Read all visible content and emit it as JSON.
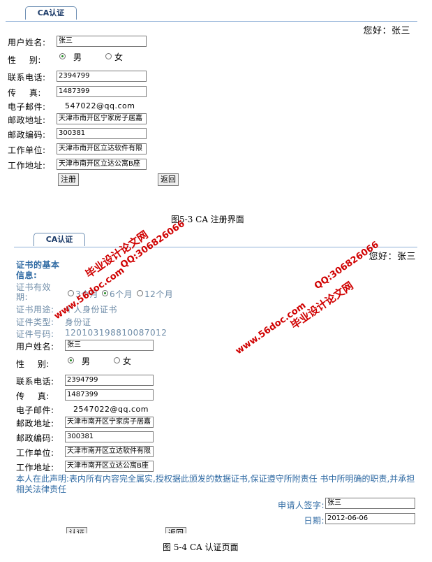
{
  "form1": {
    "tab": "CA认证",
    "greeting": "您好：张三",
    "labels": {
      "name": "用户姓名:",
      "gender": "性 别:",
      "phone": "联系电话:",
      "fax": "传 真:",
      "email": "电子邮件:",
      "address": "邮政地址:",
      "zip": "邮政编码:",
      "work_unit": "工作单位:",
      "work_address": "工作地址:"
    },
    "values": {
      "name": "张三",
      "gender_male": "男",
      "gender_female": "女",
      "phone": "2394799",
      "fax": "1487399",
      "email": "547022@qq.com",
      "address": "天津市南开区宁家房子居嘉",
      "zip": "300381",
      "work_unit": "天津市南开区立达软件有限",
      "work_address": "天津市南开区立达公寓B座"
    },
    "buttons": {
      "register": "注册",
      "back": "返回"
    },
    "caption": "图5-3 CA 注册界面"
  },
  "form2": {
    "tab": "CA认证",
    "greeting": "您好：张三",
    "cert_section_title": "证书的基本信息:",
    "cert_validity_label": "证书有效期:",
    "cert_validity_options": [
      "3个月",
      "6个月",
      "12个月"
    ],
    "cert_usage_label": "证书用途:",
    "cert_usage_value": "个人身份证书",
    "cert_type_label": "证件类型:",
    "cert_type_value": "身份证",
    "cert_number_label": "证件号码:",
    "cert_number_value": "120103198810087012",
    "labels": {
      "name": "用户姓名:",
      "gender": "性 别:",
      "phone": "联系电话:",
      "fax": "传 真:",
      "email": "电子邮件:",
      "address": "邮政地址:",
      "zip": "邮政编码:",
      "work_unit": "工作单位:",
      "work_address": "工作地址:"
    },
    "values": {
      "name": "张三",
      "gender_male": "男",
      "gender_female": "女",
      "phone": "2394799",
      "fax": "1487399",
      "email": "2547022@qq.com",
      "address": "天津市南开区宁家房子居嘉",
      "zip": "300381",
      "work_unit": "天津市南开区立达软件有限",
      "work_address": "天津市南开区立达公寓B座"
    },
    "statement": "本人在此声明:表内所有内容完全属实,授权据此颁发的数据证书,保证遵守所附责任 书中所明确的职责,并承担相关法律责任",
    "signature_label": "申请人签字:",
    "signature_value": "张三",
    "date_label": "日期:",
    "date_value": "2012-06-06",
    "buttons": {
      "auth": "认证",
      "back": "返回"
    },
    "caption": "图 5-4 CA 认证页面"
  },
  "watermarks": {
    "site": "毕业设计论文网",
    "url": "www.56doc.com",
    "qq": "QQ:306826066"
  }
}
